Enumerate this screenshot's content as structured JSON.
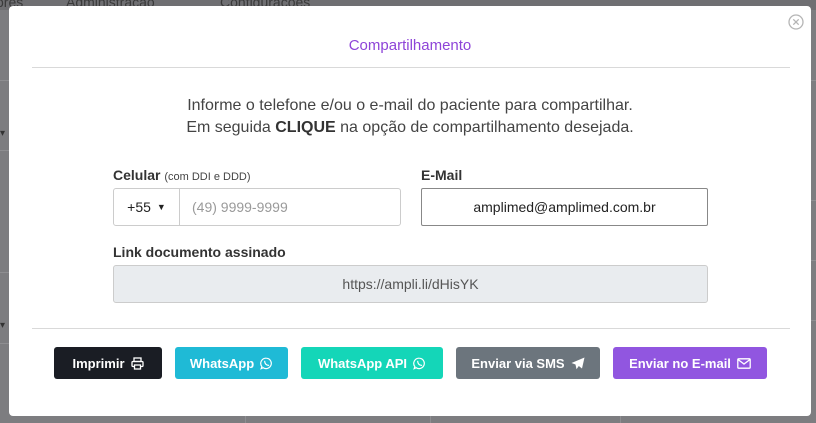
{
  "background": {
    "nav_items": [
      "ores",
      "Administração",
      "Configurações"
    ]
  },
  "modal": {
    "title": "Compartilhamento",
    "intro_line1": "Informe o telefone e/ou o e-mail do paciente para compartilhar.",
    "intro_line2_before": "Em seguida ",
    "intro_line2_bold": "CLIQUE",
    "intro_line2_after": " na opção de compartilhamento desejada.",
    "phone": {
      "label": "Celular",
      "hint": "(com DDI e DDD)",
      "ddi": "+55",
      "placeholder": "(49) 9999-9999",
      "value": ""
    },
    "email": {
      "label": "E-Mail",
      "value": "amplimed@amplimed.com.br"
    },
    "link": {
      "label": "Link documento assinado",
      "value": "https://ampli.li/dHisYK"
    },
    "buttons": {
      "print": "Imprimir",
      "whatsapp": "WhatsApp",
      "whatsapp_api": "WhatsApp API",
      "sms": "Enviar via SMS",
      "email": "Enviar no E-mail"
    },
    "colors": {
      "title": "#8e44d8",
      "print": "#1a1d24",
      "whatsapp": "#1fbad6",
      "whatsapp_api": "#14d6b8",
      "sms": "#6c757d",
      "email": "#9156e0"
    }
  }
}
